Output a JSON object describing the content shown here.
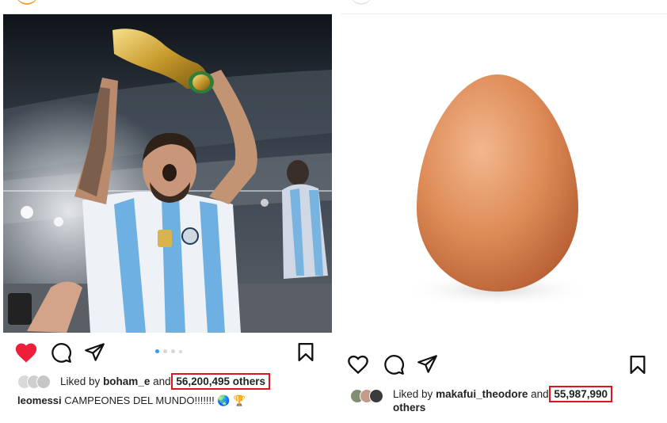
{
  "left_post": {
    "liked_by_prefix": "Liked by",
    "liked_by_user": "boham_e",
    "and_text": "and",
    "likes_count": "56,200,495 others",
    "caption_user": "leomessi",
    "caption_text": "CAMPEONES DEL MUNDO!!!!!!! 🌏 🏆",
    "carousel_dots": 4,
    "carousel_active_index": 0,
    "liked": true
  },
  "right_post": {
    "liked_by_prefix": "Liked by",
    "liked_by_user": "makafui_theodore",
    "and_text": "and",
    "likes_count": "55,987,990",
    "likes_suffix": "others",
    "liked": false
  },
  "colors": {
    "like_red": "#ed1f3a",
    "highlight_box": "#e0141e",
    "carousel_active": "#3897f0",
    "story_ring": "#f39c2a"
  },
  "icons": [
    "heart-icon",
    "comment-icon",
    "share-icon",
    "bookmark-icon"
  ]
}
